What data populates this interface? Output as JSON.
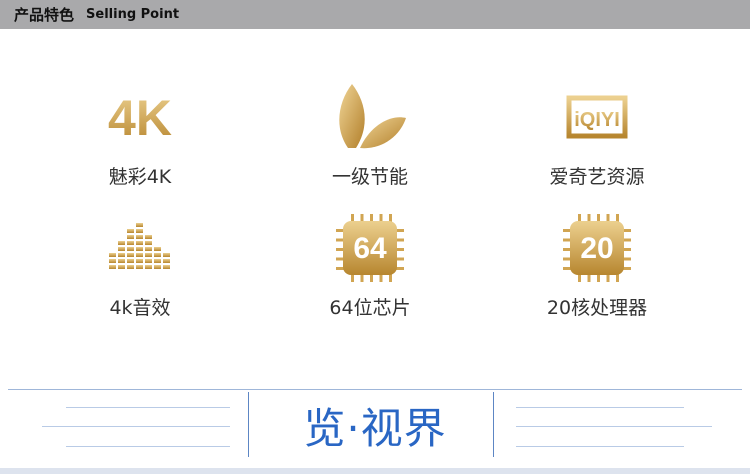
{
  "header": {
    "title_cn": "产品特色",
    "title_en": "Selling Point"
  },
  "features": [
    {
      "label": "魅彩4K",
      "icon": "4k-text-icon",
      "icon_text": "4K"
    },
    {
      "label": "一级节能",
      "icon": "leaf-icon"
    },
    {
      "label": "爱奇艺资源",
      "icon": "iqiyi-logo-icon",
      "icon_text": "iQIYI"
    },
    {
      "label": "4k音效",
      "icon": "equalizer-icon"
    },
    {
      "label": "64位芯片",
      "icon": "chip-64-icon",
      "icon_text": "64"
    },
    {
      "label": "20核处理器",
      "icon": "chip-20-icon",
      "icon_text": "20"
    }
  ],
  "footer": {
    "brand": "览·视界"
  },
  "colors": {
    "gold_light": "#e9c77d",
    "gold_dark": "#b8862f",
    "header_bg": "#a9a9ab",
    "brand_blue": "#2966c4"
  }
}
